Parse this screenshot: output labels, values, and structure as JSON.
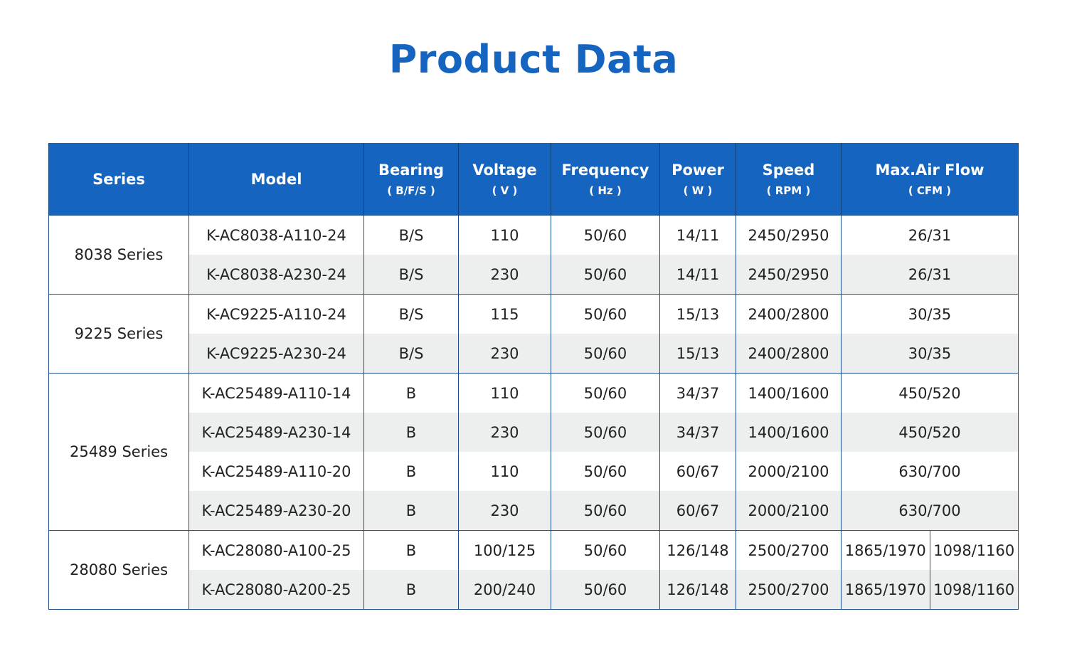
{
  "title": "Product Data",
  "headers": [
    {
      "main": "Series",
      "unit": ""
    },
    {
      "main": "Model",
      "unit": ""
    },
    {
      "main": "Bearing",
      "unit": "( B/F/S )"
    },
    {
      "main": "Voltage",
      "unit": "( V )"
    },
    {
      "main": "Frequency",
      "unit": "( Hz )"
    },
    {
      "main": "Power",
      "unit": "( W )"
    },
    {
      "main": "Speed",
      "unit": "( RPM )"
    },
    {
      "main": "Max.Air Flow",
      "unit": "( CFM )"
    }
  ],
  "groups": [
    {
      "series": "8038 Series",
      "rows": [
        {
          "model": "K-AC8038-A110-24",
          "bearing": "B/S",
          "voltage": "110",
          "frequency": "50/60",
          "power": "14/11",
          "speed": "2450/2950",
          "airflow": [
            "26/31"
          ]
        },
        {
          "model": "K-AC8038-A230-24",
          "bearing": "B/S",
          "voltage": "230",
          "frequency": "50/60",
          "power": "14/11",
          "speed": "2450/2950",
          "airflow": [
            "26/31"
          ]
        }
      ]
    },
    {
      "series": "9225 Series",
      "rows": [
        {
          "model": "K-AC9225-A110-24",
          "bearing": "B/S",
          "voltage": "115",
          "frequency": "50/60",
          "power": "15/13",
          "speed": "2400/2800",
          "airflow": [
            "30/35"
          ]
        },
        {
          "model": "K-AC9225-A230-24",
          "bearing": "B/S",
          "voltage": "230",
          "frequency": "50/60",
          "power": "15/13",
          "speed": "2400/2800",
          "airflow": [
            "30/35"
          ]
        }
      ]
    },
    {
      "series": "25489 Series",
      "rows": [
        {
          "model": "K-AC25489-A110-14",
          "bearing": "B",
          "voltage": "110",
          "frequency": "50/60",
          "power": "34/37",
          "speed": "1400/1600",
          "airflow": [
            "450/520"
          ]
        },
        {
          "model": "K-AC25489-A230-14",
          "bearing": "B",
          "voltage": "230",
          "frequency": "50/60",
          "power": "34/37",
          "speed": "1400/1600",
          "airflow": [
            "450/520"
          ]
        },
        {
          "model": "K-AC25489-A110-20",
          "bearing": "B",
          "voltage": "110",
          "frequency": "50/60",
          "power": "60/67",
          "speed": "2000/2100",
          "airflow": [
            "630/700"
          ]
        },
        {
          "model": "K-AC25489-A230-20",
          "bearing": "B",
          "voltage": "230",
          "frequency": "50/60",
          "power": "60/67",
          "speed": "2000/2100",
          "airflow": [
            "630/700"
          ]
        }
      ]
    },
    {
      "series": "28080 Series",
      "rows": [
        {
          "model": "K-AC28080-A100-25",
          "bearing": "B",
          "voltage": "100/125",
          "frequency": "50/60",
          "power": "126/148",
          "speed": "2500/2700",
          "airflow": [
            "1865/1970",
            "1098/1160"
          ]
        },
        {
          "model": "K-AC28080-A200-25",
          "bearing": "B",
          "voltage": "200/240",
          "frequency": "50/60",
          "power": "126/148",
          "speed": "2500/2700",
          "airflow": [
            "1865/1970",
            "1098/1160"
          ]
        }
      ]
    }
  ]
}
